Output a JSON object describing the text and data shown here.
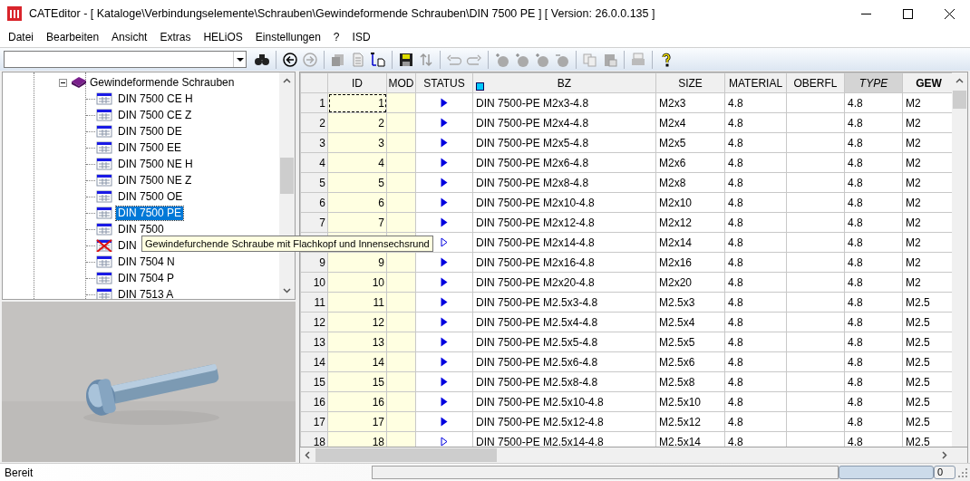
{
  "window": {
    "title": "CATEditor - [ Kataloge\\Verbindungselemente\\Schrauben\\Gewindeformende Schrauben\\DIN 7500 PE ]  [ Version: 26.0.0.135 ]"
  },
  "menu": [
    "Datei",
    "Bearbeiten",
    "Ansicht",
    "Extras",
    "HELiOS",
    "Einstellungen",
    "?",
    "ISD"
  ],
  "tree": {
    "label": "Gewindeformende Schrauben",
    "expanded": true,
    "children": [
      {
        "label": "DIN 7500 CE H",
        "selected": false,
        "crossed": false
      },
      {
        "label": "DIN 7500 CE Z",
        "selected": false,
        "crossed": false
      },
      {
        "label": "DIN 7500 DE",
        "selected": false,
        "crossed": false
      },
      {
        "label": "DIN 7500 EE",
        "selected": false,
        "crossed": false
      },
      {
        "label": "DIN 7500 NE H",
        "selected": false,
        "crossed": false
      },
      {
        "label": "DIN 7500 NE Z",
        "selected": false,
        "crossed": false
      },
      {
        "label": "DIN 7500 OE",
        "selected": false,
        "crossed": false
      },
      {
        "label": "DIN 7500 PE",
        "selected": true,
        "crossed": false
      },
      {
        "label": "DIN 7500",
        "selected": false,
        "crossed": false
      },
      {
        "label": "DIN",
        "selected": false,
        "crossed": true
      },
      {
        "label": "DIN 7504 N",
        "selected": false,
        "crossed": false
      },
      {
        "label": "DIN 7504 P",
        "selected": false,
        "crossed": false
      },
      {
        "label": "DIN 7513 A",
        "selected": false,
        "crossed": false
      }
    ]
  },
  "tooltip": "Gewindefurchende Schraube mit Flachkopf und Innensechsrund",
  "table": {
    "columns": [
      "ID",
      "MOD",
      "STATUS",
      "BZ",
      "SIZE",
      "MATERIAL",
      "OBERFL",
      "TYPE",
      "GEW"
    ],
    "rows": [
      {
        "num": "1",
        "id": "1",
        "kind": "filled",
        "bz": "DIN 7500-PE M2x3-4.8",
        "size": "M2x3",
        "material": "4.8",
        "type": "4.8",
        "gew": "M2",
        "focused": true
      },
      {
        "num": "2",
        "id": "2",
        "kind": "filled",
        "bz": "DIN 7500-PE M2x4-4.8",
        "size": "M2x4",
        "material": "4.8",
        "type": "4.8",
        "gew": "M2",
        "focused": false
      },
      {
        "num": "3",
        "id": "3",
        "kind": "filled",
        "bz": "DIN 7500-PE M2x5-4.8",
        "size": "M2x5",
        "material": "4.8",
        "type": "4.8",
        "gew": "M2",
        "focused": false
      },
      {
        "num": "4",
        "id": "4",
        "kind": "filled",
        "bz": "DIN 7500-PE M2x6-4.8",
        "size": "M2x6",
        "material": "4.8",
        "type": "4.8",
        "gew": "M2",
        "focused": false
      },
      {
        "num": "5",
        "id": "5",
        "kind": "filled",
        "bz": "DIN 7500-PE M2x8-4.8",
        "size": "M2x8",
        "material": "4.8",
        "type": "4.8",
        "gew": "M2",
        "focused": false
      },
      {
        "num": "6",
        "id": "6",
        "kind": "filled",
        "bz": "DIN 7500-PE M2x10-4.8",
        "size": "M2x10",
        "material": "4.8",
        "type": "4.8",
        "gew": "M2",
        "focused": false
      },
      {
        "num": "7",
        "id": "7",
        "kind": "filled",
        "bz": "DIN 7500-PE M2x12-4.8",
        "size": "M2x12",
        "material": "4.8",
        "type": "4.8",
        "gew": "M2",
        "focused": false
      },
      {
        "kind": "hollow",
        "bz": "DIN 7500-PE M2x14-4.8",
        "size": "M2x14",
        "material": "4.8",
        "type": "4.8",
        "gew": "M2",
        "focused": false
      },
      {
        "num": "9",
        "id": "9",
        "kind": "filled",
        "bz": "DIN 7500-PE M2x16-4.8",
        "size": "M2x16",
        "material": "4.8",
        "type": "4.8",
        "gew": "M2",
        "focused": false
      },
      {
        "num": "10",
        "id": "10",
        "kind": "filled",
        "bz": "DIN 7500-PE M2x20-4.8",
        "size": "M2x20",
        "material": "4.8",
        "type": "4.8",
        "gew": "M2",
        "focused": false
      },
      {
        "num": "11",
        "id": "11",
        "kind": "filled",
        "bz": "DIN 7500-PE M2.5x3-4.8",
        "size": "M2.5x3",
        "material": "4.8",
        "type": "4.8",
        "gew": "M2.5",
        "focused": false
      },
      {
        "num": "12",
        "id": "12",
        "kind": "filled",
        "bz": "DIN 7500-PE M2.5x4-4.8",
        "size": "M2.5x4",
        "material": "4.8",
        "type": "4.8",
        "gew": "M2.5",
        "focused": false
      },
      {
        "num": "13",
        "id": "13",
        "kind": "filled",
        "bz": "DIN 7500-PE M2.5x5-4.8",
        "size": "M2.5x5",
        "material": "4.8",
        "type": "4.8",
        "gew": "M2.5",
        "focused": false
      },
      {
        "num": "14",
        "id": "14",
        "kind": "filled",
        "bz": "DIN 7500-PE M2.5x6-4.8",
        "size": "M2.5x6",
        "material": "4.8",
        "type": "4.8",
        "gew": "M2.5",
        "focused": false
      },
      {
        "num": "15",
        "id": "15",
        "kind": "filled",
        "bz": "DIN 7500-PE M2.5x8-4.8",
        "size": "M2.5x8",
        "material": "4.8",
        "type": "4.8",
        "gew": "M2.5",
        "focused": false
      },
      {
        "num": "16",
        "id": "16",
        "kind": "filled",
        "bz": "DIN 7500-PE M2.5x10-4.8",
        "size": "M2.5x10",
        "material": "4.8",
        "type": "4.8",
        "gew": "M2.5",
        "focused": false
      },
      {
        "num": "17",
        "id": "17",
        "kind": "filled",
        "bz": "DIN 7500-PE M2.5x12-4.8",
        "size": "M2.5x12",
        "material": "4.8",
        "type": "4.8",
        "gew": "M2.5",
        "focused": false
      },
      {
        "num": "18",
        "id": "18",
        "kind": "hollow",
        "bz": "DIN 7500-PE M2.5x14-4.8",
        "size": "M2.5x14",
        "material": "4.8",
        "type": "4.8",
        "gew": "M2.5",
        "focused": false
      }
    ]
  },
  "status_bar": {
    "text": "Bereit",
    "count": "0"
  }
}
